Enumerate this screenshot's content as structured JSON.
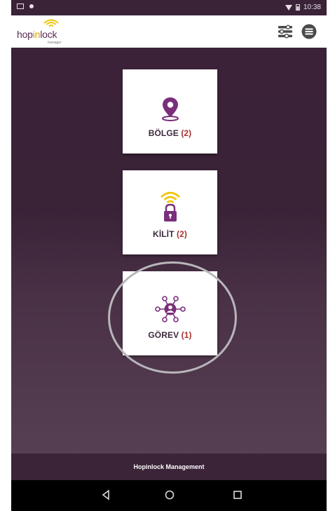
{
  "status_bar": {
    "time": "10:38"
  },
  "app_bar": {
    "logo_word_1": "hop",
    "logo_word_2": "in",
    "logo_word_3": "lock",
    "logo_sub": "manager"
  },
  "tiles": [
    {
      "label": "BÖLGE",
      "count": "(2)",
      "icon": "location-pin-icon"
    },
    {
      "label": "KİLİT",
      "count": "(2)",
      "icon": "padlock-wifi-icon"
    },
    {
      "label": "GÖREV",
      "count": "(1)",
      "icon": "task-network-icon"
    }
  ],
  "footer": {
    "text": "Hopinlock Management"
  },
  "colors": {
    "brand_purple": "#7a2f7a",
    "brand_yellow": "#f2c200",
    "count_red": "#a8322f",
    "background": "#3a2237"
  }
}
